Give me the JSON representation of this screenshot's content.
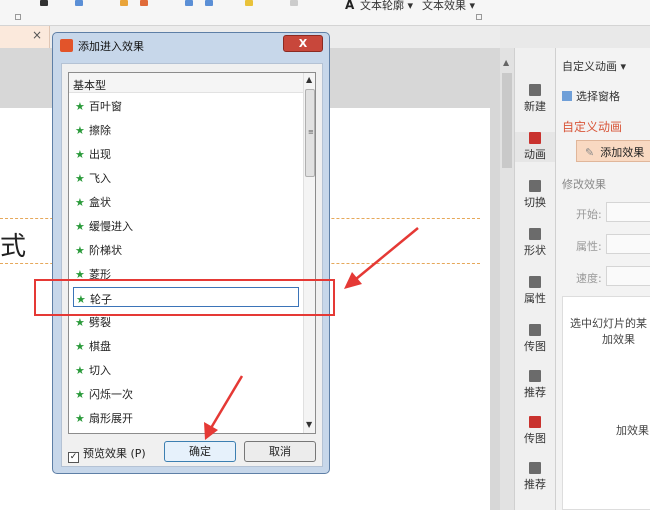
{
  "toolbar": {
    "text_outline": "文本轮廓 ▾",
    "text_effect": "文本效果 ▾",
    "text_a": "A"
  },
  "tabstrip": {
    "close_glyph": "×"
  },
  "slide": {
    "partial_text": "式"
  },
  "dialog": {
    "title": "添加进入效果",
    "close_glyph": "X",
    "list_header": "基本型",
    "items": [
      "百叶窗",
      "擦除",
      "出现",
      "飞入",
      "盒状",
      "缓慢进入",
      "阶梯状",
      "菱形",
      "轮子",
      "劈裂",
      "棋盘",
      "切入",
      "闪烁一次",
      "扇形展开"
    ],
    "selected_index": 8,
    "preview_label": "预览效果 (P)",
    "preview_checked": "✓",
    "ok_label": "确定",
    "cancel_label": "取消"
  },
  "sidebar": {
    "items": [
      {
        "label": "新建"
      },
      {
        "label": "动画"
      },
      {
        "label": "切换"
      },
      {
        "label": "形状"
      },
      {
        "label": "属性"
      },
      {
        "label": "传图"
      },
      {
        "label": "推荐"
      },
      {
        "label": "传图"
      },
      {
        "label": "推荐"
      }
    ]
  },
  "pane": {
    "custom_anim_dropdown": "自定义动画 ▾",
    "select_pane": "选择窗格",
    "header": "自定义动画",
    "add_effect": "添加效果",
    "modify_effect": "修改效果",
    "start_label": "开始:",
    "property_label": "属性:",
    "speed_label": "速度:",
    "hint_line1": "选中幻灯片的某",
    "hint_line2": "加效果",
    "hint_line3": "加效果"
  },
  "colors": {
    "accent": "#d9573a",
    "annotation": "#e53935",
    "selection": "#3b74b8"
  }
}
